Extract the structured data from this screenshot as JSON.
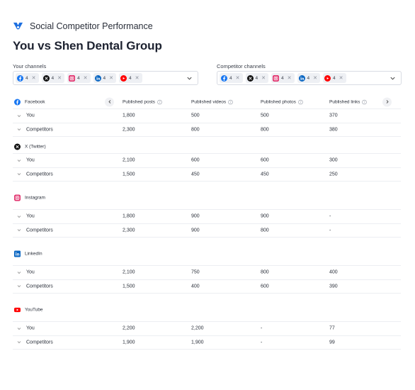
{
  "header": {
    "brand_name": "Social Competitor Performance",
    "title": "You vs Shen Dental Group"
  },
  "your_channels": {
    "label": "Your channels",
    "chips": [
      {
        "icon": "facebook-icon",
        "count": "4"
      },
      {
        "icon": "x-twitter-icon",
        "count": "4"
      },
      {
        "icon": "instagram-icon",
        "count": "4"
      },
      {
        "icon": "linkedin-icon",
        "count": "4"
      },
      {
        "icon": "youtube-icon",
        "count": "4"
      }
    ]
  },
  "competitor_channels": {
    "label": "Competitor channels",
    "chips": [
      {
        "icon": "facebook-icon",
        "count": "4"
      },
      {
        "icon": "x-twitter-icon",
        "count": "4"
      },
      {
        "icon": "instagram-icon",
        "count": "4"
      },
      {
        "icon": "linkedin-icon",
        "count": "4"
      },
      {
        "icon": "youtube-icon",
        "count": "4"
      }
    ]
  },
  "table": {
    "columns": [
      "Published posts",
      "Published videos",
      "Published photos",
      "Published links"
    ],
    "sections": [
      {
        "platform": "Facebook",
        "rows": [
          {
            "label": "You",
            "values": [
              "1,800",
              "500",
              "500",
              "370"
            ]
          },
          {
            "label": "Competitors",
            "values": [
              "2,300",
              "800",
              "800",
              "380"
            ]
          }
        ]
      },
      {
        "platform": "X (Twitter)",
        "rows": [
          {
            "label": "You",
            "values": [
              "2,100",
              "600",
              "600",
              "300"
            ]
          },
          {
            "label": "Competitors",
            "values": [
              "1,500",
              "450",
              "450",
              "250"
            ]
          }
        ]
      },
      {
        "platform": "Instagram",
        "rows": [
          {
            "label": "You",
            "values": [
              "1,800",
              "900",
              "900",
              "-"
            ]
          },
          {
            "label": "Competitors",
            "values": [
              "2,300",
              "900",
              "800",
              "-"
            ]
          }
        ]
      },
      {
        "platform": "LinkedIn",
        "rows": [
          {
            "label": "You",
            "values": [
              "2,100",
              "750",
              "800",
              "400"
            ]
          },
          {
            "label": "Competitors",
            "values": [
              "1,500",
              "400",
              "600",
              "390"
            ]
          }
        ]
      },
      {
        "platform": "YouTube",
        "rows": [
          {
            "label": "You",
            "values": [
              "2,200",
              "2,200",
              "-",
              "77"
            ]
          },
          {
            "label": "Competitors",
            "values": [
              "1,900",
              "1,900",
              "-",
              "99"
            ]
          }
        ]
      }
    ]
  },
  "colors": {
    "facebook": "#1877f2",
    "x": "#111111",
    "instagram": "#e1306c",
    "linkedin": "#0a66c2",
    "youtube": "#ff0000",
    "brand": "#1d6fe0"
  }
}
